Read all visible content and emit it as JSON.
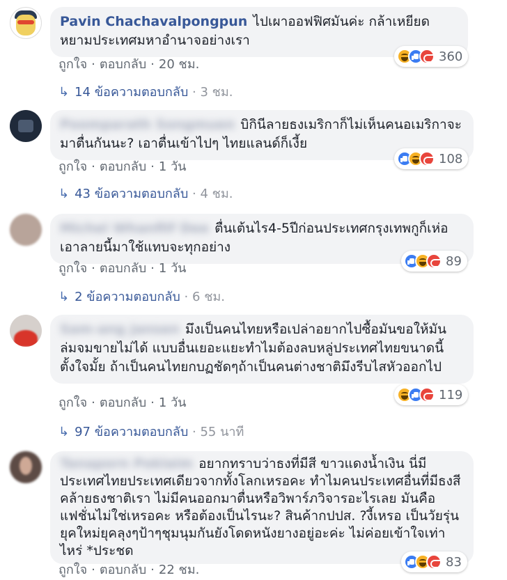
{
  "comments": [
    {
      "author": "Pavin Chachavalpongpun",
      "text": "ไปเผาออฟฟิศมันค่ะ กล้าเหยียดหยามประเทศมหาอำนาจอย่างเรา",
      "like_label": "ถูกใจ",
      "reply_label": "ตอบกลับ",
      "time": "20 ชม.",
      "reactions": [
        "haha",
        "like",
        "angry"
      ],
      "reaction_count": "360",
      "replies_count": "14",
      "replies_label": "ข้อความตอบกลับ",
      "replies_time": "3 ชม."
    },
    {
      "author": "Poomparath Songmuen",
      "text": "บิกินีลายธงเมริกาก็ไม่เห็นคนอเมริกาจะมาตื่นกันนะ? เอาตื่นเข้าไปๆ ไทยแลนด์ก็เงี้ย",
      "like_label": "ถูกใจ",
      "reply_label": "ตอบกลับ",
      "time": "1 วัน",
      "reactions": [
        "like",
        "haha",
        "angry"
      ],
      "reaction_count": "108",
      "replies_count": "43",
      "replies_label": "ข้อความตอบกลับ",
      "replies_time": "4 ชม."
    },
    {
      "author": "Michel Whanfilf Dee",
      "text": "ตื่นเต้นไร4-5ปีก่อนประเทศกรุงเทพกูก็เห่อเอาลายนี้มาใช้แทบจะทุกอย่าง",
      "like_label": "ถูกใจ",
      "reply_label": "ตอบกลับ",
      "time": "1 วัน",
      "reactions": [
        "like",
        "haha",
        "angry"
      ],
      "reaction_count": "89",
      "replies_count": "2",
      "replies_label": "ข้อความตอบกลับ",
      "replies_time": "6 ชม."
    },
    {
      "author": "Sam-ang Jansen",
      "text": "มึงเป็นคนไทยหรือเปล่าอยากไปซื้อมันขอให้มันล่มจมขายไม่ได้ แบบอื่นเยอะแยะทำไมต้องลบหลู่ประเทศไทยขนาดนี้ตั้งใจมั้ย ถ้าเป็นคนไทยกบฏชัดๆถ้าเป็นคนต่างชาติมึงรีบไสหัวออกไป",
      "like_label": "ถูกใจ",
      "reply_label": "ตอบกลับ",
      "time": "1 วัน",
      "reactions": [
        "haha",
        "like",
        "angry"
      ],
      "reaction_count": "119",
      "replies_count": "97",
      "replies_label": "ข้อความตอบกลับ",
      "replies_time": "55 นาที"
    },
    {
      "author": "Tanaporn Poklaim",
      "text": "อยากทราบว่าธงที่มีสี ขาวแดงน้ำเงิน นี่มีประเทศไทยประเทศเดียวจากทั้งโลกเหรอคะ ทำไมคนประเทศอื่นที่มีธงสีคล้ายธงชาติเรา ไม่มีคนออกมาตื่นหรือวิพาร์ภวิจารอะไรเลย มันคือแฟชั่นไม่ใช่เหรอคะ หรือต้องเป็นไรนะ? สินค้ากปปส. ?งี้เหรอ เป็นวัยรุ่นยุคใหม่ยุคลุงๆป้าๆชุมนุมกันยังโดดหนังยางอยู่อะค่ะ ไม่ค่อยเข้าใจเท่าไหร่ *ประชด",
      "like_label": "ถูกใจ",
      "reply_label": "ตอบกลับ",
      "time": "22 ชม.",
      "reactions": [
        "like",
        "haha",
        "angry"
      ],
      "reaction_count": "83"
    }
  ],
  "dot": "·",
  "reply_arrow": "↳"
}
